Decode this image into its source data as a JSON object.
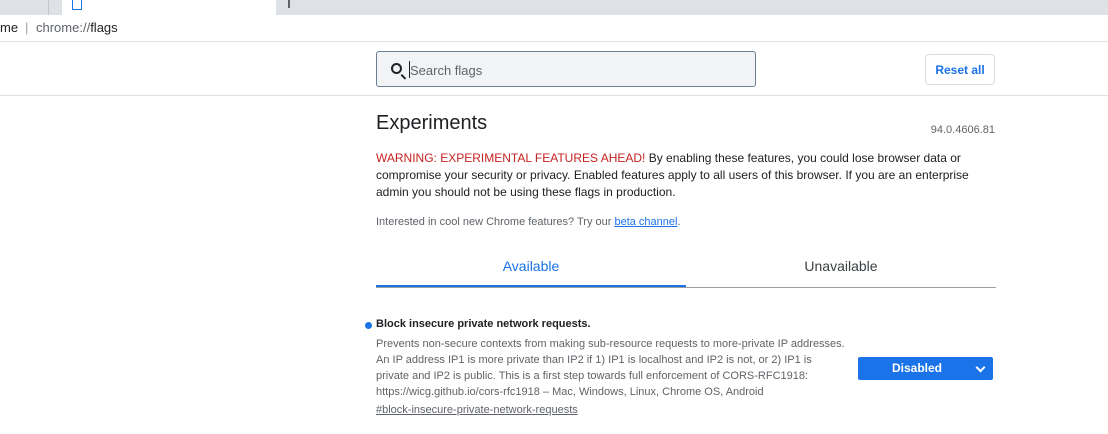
{
  "address_bar": {
    "prefix": "me",
    "url_scheme": "chrome://",
    "url_path": "flags"
  },
  "search": {
    "placeholder": "Search flags",
    "value": ""
  },
  "header": {
    "reset_label": "Reset all"
  },
  "page": {
    "title": "Experiments",
    "version": "94.0.4606.81",
    "warning_lead": "WARNING: EXPERIMENTAL FEATURES AHEAD!",
    "warning_body": " By enabling these features, you could lose browser data or compromise your security or privacy. Enabled features apply to all users of this browser. If you are an enterprise admin you should not be using these flags in production.",
    "beta_prefix": "Interested in cool new Chrome features? Try our ",
    "beta_link": "beta channel",
    "beta_suffix": "."
  },
  "tabs": [
    {
      "label": "Available",
      "selected": true
    },
    {
      "label": "Unavailable",
      "selected": false
    }
  ],
  "flags": [
    {
      "title": "Block insecure private network requests.",
      "description": "Prevents non-secure contexts from making sub-resource requests to more-private IP addresses. An IP address IP1 is more private than IP2 if 1) IP1 is localhost and IP2 is not, or 2) IP1 is private and IP2 is public. This is a first step towards full enforcement of CORS-RFC1918: https://wicg.github.io/cors-rfc1918 – Mac, Windows, Linux, Chrome OS, Android",
      "link": "#block-insecure-private-network-requests",
      "state": "Disabled"
    }
  ],
  "colors": {
    "accent": "#1a73e8",
    "warning": "#c5221f"
  }
}
